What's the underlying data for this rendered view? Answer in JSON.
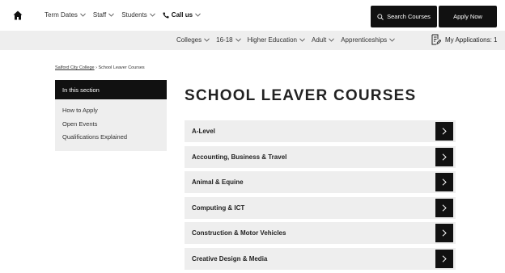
{
  "topnav": {
    "items": [
      {
        "label": "Term Dates"
      },
      {
        "label": "Staff"
      },
      {
        "label": "Students"
      }
    ],
    "call_label": "Call us",
    "search_label": "Search Courses",
    "apply_label": "Apply Now"
  },
  "subnav": {
    "items": [
      {
        "label": "Colleges"
      },
      {
        "label": "16-18"
      },
      {
        "label": "Higher Education"
      },
      {
        "label": "Adult"
      },
      {
        "label": "Apprenticeships"
      }
    ],
    "my_applications": "My Applications: 1"
  },
  "breadcrumb": {
    "home": "Salford City College",
    "separator": " › ",
    "current": "School Leaver Courses"
  },
  "sidebar": {
    "heading": "In this section",
    "items": [
      {
        "label": "How to Apply"
      },
      {
        "label": "Open Events"
      },
      {
        "label": "Qualifications Explained"
      }
    ]
  },
  "main": {
    "title": "SCHOOL LEAVER COURSES",
    "courses": [
      {
        "label": "A-Level"
      },
      {
        "label": "Accounting, Business & Travel"
      },
      {
        "label": "Animal & Equine"
      },
      {
        "label": "Computing & ICT"
      },
      {
        "label": "Construction & Motor Vehicles"
      },
      {
        "label": "Creative Design & Media"
      }
    ]
  },
  "colors": {
    "dark": "#111111",
    "panel": "#eeeeee",
    "text": "#222222"
  },
  "icons": {
    "home": "home-icon",
    "phone": "phone-icon",
    "search": "search-icon",
    "applications": "document-edit-icon",
    "arrow": "chevron-right-icon"
  }
}
